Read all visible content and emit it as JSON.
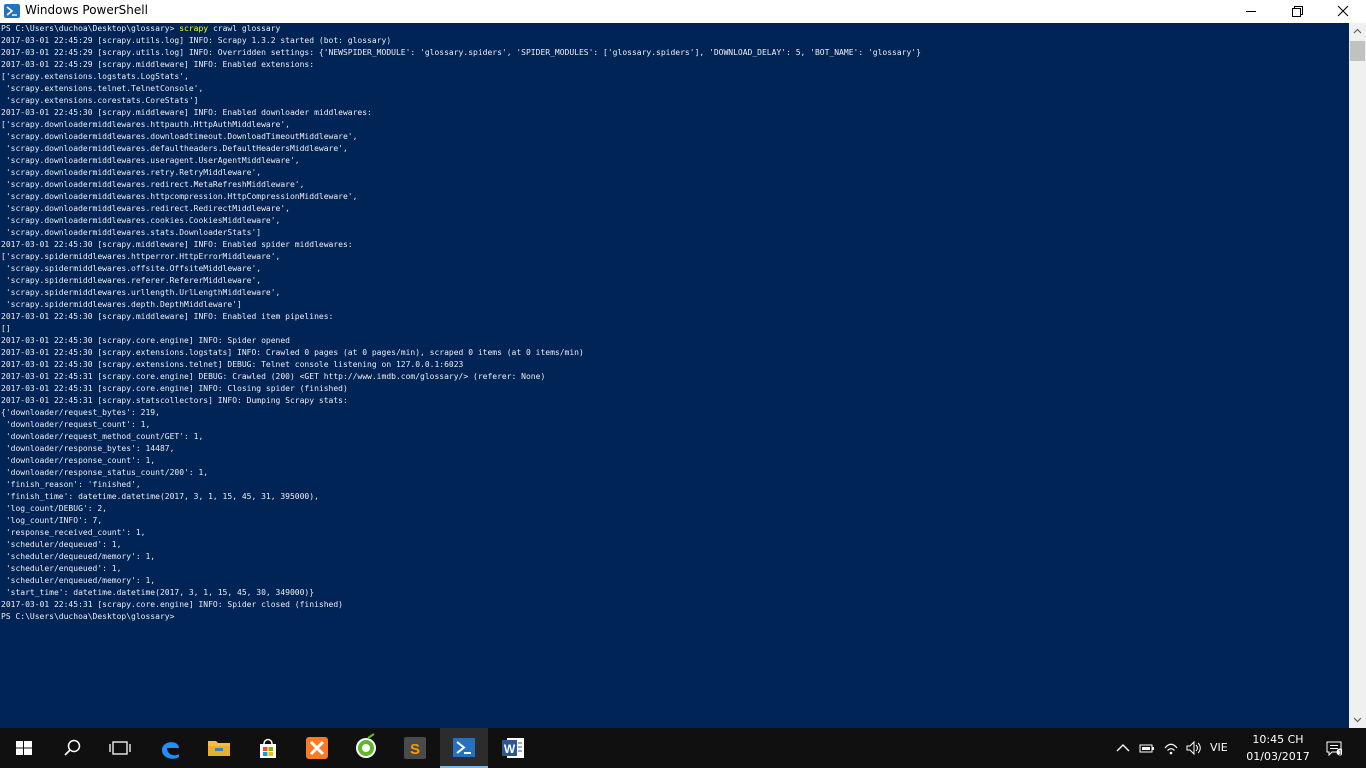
{
  "window": {
    "title": "Windows PowerShell"
  },
  "console": {
    "lines": [
      {
        "text": "PS C:\\Users\\duchoa\\Desktop\\glossary> ",
        "cmd": "scrapy",
        "args": " crawl glossary"
      },
      {
        "text": "2017-03-01 22:45:29 [scrapy.utils.log] INFO: Scrapy 1.3.2 started (bot: glossary)"
      },
      {
        "text": "2017-03-01 22:45:29 [scrapy.utils.log] INFO: Overridden settings: {'NEWSPIDER_MODULE': 'glossary.spiders', 'SPIDER_MODULES': ['glossary.spiders'], 'DOWNLOAD_DELAY': 5, 'BOT_NAME': 'glossary'}"
      },
      {
        "text": "2017-03-01 22:45:29 [scrapy.middleware] INFO: Enabled extensions:"
      },
      {
        "text": "['scrapy.extensions.logstats.LogStats',"
      },
      {
        "text": " 'scrapy.extensions.telnet.TelnetConsole',"
      },
      {
        "text": " 'scrapy.extensions.corestats.CoreStats']"
      },
      {
        "text": "2017-03-01 22:45:30 [scrapy.middleware] INFO: Enabled downloader middlewares:"
      },
      {
        "text": "['scrapy.downloadermiddlewares.httpauth.HttpAuthMiddleware',"
      },
      {
        "text": " 'scrapy.downloadermiddlewares.downloadtimeout.DownloadTimeoutMiddleware',"
      },
      {
        "text": " 'scrapy.downloadermiddlewares.defaultheaders.DefaultHeadersMiddleware',"
      },
      {
        "text": " 'scrapy.downloadermiddlewares.useragent.UserAgentMiddleware',"
      },
      {
        "text": " 'scrapy.downloadermiddlewares.retry.RetryMiddleware',"
      },
      {
        "text": " 'scrapy.downloadermiddlewares.redirect.MetaRefreshMiddleware',"
      },
      {
        "text": " 'scrapy.downloadermiddlewares.httpcompression.HttpCompressionMiddleware',"
      },
      {
        "text": " 'scrapy.downloadermiddlewares.redirect.RedirectMiddleware',"
      },
      {
        "text": " 'scrapy.downloadermiddlewares.cookies.CookiesMiddleware',"
      },
      {
        "text": " 'scrapy.downloadermiddlewares.stats.DownloaderStats']"
      },
      {
        "text": "2017-03-01 22:45:30 [scrapy.middleware] INFO: Enabled spider middlewares:"
      },
      {
        "text": "['scrapy.spidermiddlewares.httperror.HttpErrorMiddleware',"
      },
      {
        "text": " 'scrapy.spidermiddlewares.offsite.OffsiteMiddleware',"
      },
      {
        "text": " 'scrapy.spidermiddlewares.referer.RefererMiddleware',"
      },
      {
        "text": " 'scrapy.spidermiddlewares.urllength.UrlLengthMiddleware',"
      },
      {
        "text": " 'scrapy.spidermiddlewares.depth.DepthMiddleware']"
      },
      {
        "text": "2017-03-01 22:45:30 [scrapy.middleware] INFO: Enabled item pipelines:"
      },
      {
        "text": "[]"
      },
      {
        "text": "2017-03-01 22:45:30 [scrapy.core.engine] INFO: Spider opened"
      },
      {
        "text": "2017-03-01 22:45:30 [scrapy.extensions.logstats] INFO: Crawled 0 pages (at 0 pages/min), scraped 0 items (at 0 items/min)"
      },
      {
        "text": "2017-03-01 22:45:30 [scrapy.extensions.telnet] DEBUG: Telnet console listening on 127.0.0.1:6023"
      },
      {
        "text": "2017-03-01 22:45:31 [scrapy.core.engine] DEBUG: Crawled (200) <GET http://www.imdb.com/glossary/> (referer: None)"
      },
      {
        "text": "2017-03-01 22:45:31 [scrapy.core.engine] INFO: Closing spider (finished)"
      },
      {
        "text": "2017-03-01 22:45:31 [scrapy.statscollectors] INFO: Dumping Scrapy stats:"
      },
      {
        "text": "{'downloader/request_bytes': 219,"
      },
      {
        "text": " 'downloader/request_count': 1,"
      },
      {
        "text": " 'downloader/request_method_count/GET': 1,"
      },
      {
        "text": " 'downloader/response_bytes': 14487,"
      },
      {
        "text": " 'downloader/response_count': 1,"
      },
      {
        "text": " 'downloader/response_status_count/200': 1,"
      },
      {
        "text": " 'finish_reason': 'finished',"
      },
      {
        "text": " 'finish_time': datetime.datetime(2017, 3, 1, 15, 45, 31, 395000),"
      },
      {
        "text": " 'log_count/DEBUG': 2,"
      },
      {
        "text": " 'log_count/INFO': 7,"
      },
      {
        "text": " 'response_received_count': 1,"
      },
      {
        "text": " 'scheduler/dequeued': 1,"
      },
      {
        "text": " 'scheduler/dequeued/memory': 1,"
      },
      {
        "text": " 'scheduler/enqueued': 1,"
      },
      {
        "text": " 'scheduler/enqueued/memory': 1,"
      },
      {
        "text": " 'start_time': datetime.datetime(2017, 3, 1, 15, 45, 30, 349000)}"
      },
      {
        "text": "2017-03-01 22:45:31 [scrapy.core.engine] INFO: Spider closed (finished)"
      },
      {
        "text": "PS C:\\Users\\duchoa\\Desktop\\glossary>"
      }
    ],
    "colors": {
      "background": "#012456",
      "text": "#eeedf0",
      "command": "#ffff00"
    }
  },
  "taskbar": {
    "apps": [
      {
        "icon": "windows-start-icon"
      },
      {
        "icon": "search-icon"
      },
      {
        "icon": "task-view-icon"
      },
      {
        "icon": "edge-icon"
      },
      {
        "icon": "file-explorer-icon"
      },
      {
        "icon": "store-icon"
      },
      {
        "icon": "xampp-icon"
      },
      {
        "icon": "coccoc-browser-icon"
      },
      {
        "icon": "sublime-text-icon"
      },
      {
        "icon": "powershell-icon"
      },
      {
        "icon": "word-icon"
      }
    ],
    "tray": {
      "language": "VIE",
      "time": "10:45 CH",
      "date": "01/03/2017"
    }
  }
}
